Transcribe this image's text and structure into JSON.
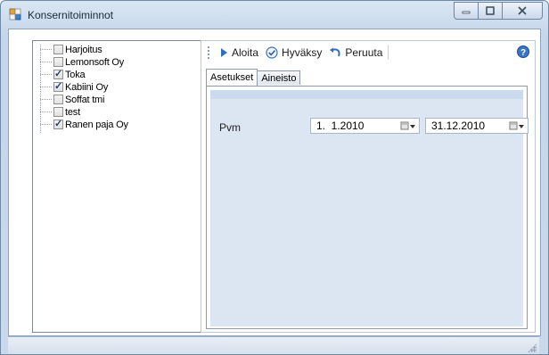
{
  "window": {
    "title": "Konsernitoiminnot"
  },
  "tree": {
    "items": [
      {
        "label": "Harjoitus",
        "checked": false
      },
      {
        "label": "Lemonsoft Oy",
        "checked": false
      },
      {
        "label": "Toka",
        "checked": true
      },
      {
        "label": "Kabiini Oy",
        "checked": true
      },
      {
        "label": "Soffat tmi",
        "checked": false
      },
      {
        "label": "test",
        "checked": false
      },
      {
        "label": "Ranen paja Oy",
        "checked": true
      }
    ]
  },
  "toolbar": {
    "start_label": "Aloita",
    "approve_label": "Hyväksy",
    "cancel_label": "Peruuta"
  },
  "tabs": [
    {
      "label": "Asetukset",
      "active": true
    },
    {
      "label": "Aineisto",
      "active": false
    }
  ],
  "settings": {
    "date_label": "Pvm",
    "date_from": "1.  1.2010",
    "date_to": "31.12.2010"
  }
}
